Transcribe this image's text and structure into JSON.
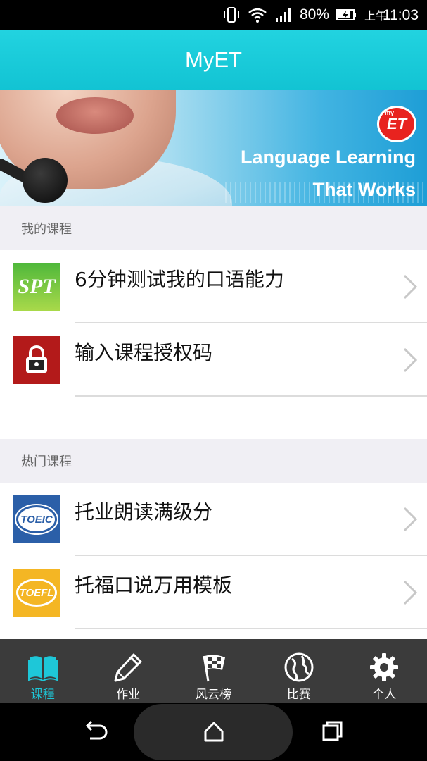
{
  "status_bar": {
    "battery": "80%",
    "ampm": "上午",
    "time": "11:03"
  },
  "app_bar": {
    "title": "MyET"
  },
  "banner": {
    "logo_small": "my",
    "logo_text": "ET",
    "tagline_1": "Language Learning",
    "tagline_2": "That Works"
  },
  "sections": {
    "my_courses": {
      "title": "我的课程",
      "items": [
        {
          "label": "6分钟测试我的口语能力",
          "icon": "spt-icon",
          "icon_text": "SPT"
        },
        {
          "label": "输入课程授权码",
          "icon": "lock-icon"
        }
      ]
    },
    "popular_courses": {
      "title": "热门课程",
      "items": [
        {
          "label": "托业朗读满级分",
          "icon": "toeic-icon",
          "icon_text": "TOEIC"
        },
        {
          "label": "托福口说万用模板",
          "icon": "toefl-icon",
          "icon_text": "TOEFL"
        }
      ]
    }
  },
  "bottom_nav": {
    "items": [
      {
        "label": "课程",
        "icon": "book-icon",
        "active": true
      },
      {
        "label": "作业",
        "icon": "pencil-icon"
      },
      {
        "label": "风云榜",
        "icon": "checkered-flag-icon"
      },
      {
        "label": "比赛",
        "icon": "globe-icon"
      },
      {
        "label": "个人",
        "icon": "gear-icon"
      }
    ]
  },
  "colors": {
    "accent": "#1ec7d8",
    "app_bar": "#12c3d3",
    "nav_bg": "#3b3b3b",
    "section_bg": "#f0eff4"
  }
}
